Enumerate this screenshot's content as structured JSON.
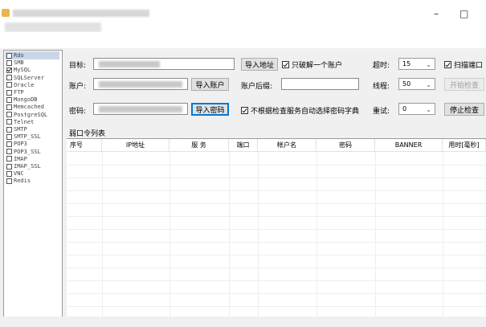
{
  "window": {
    "minimize_glyph": "–",
    "maximize_glyph": "□"
  },
  "services": [
    {
      "label": "Rdo",
      "checked": false
    },
    {
      "label": "SMB",
      "checked": false
    },
    {
      "label": "MySQL",
      "checked": true
    },
    {
      "label": "SQLServer",
      "checked": false
    },
    {
      "label": "Oracle",
      "checked": false
    },
    {
      "label": "FTP",
      "checked": false
    },
    {
      "label": "MongoDB",
      "checked": false
    },
    {
      "label": "Memcached",
      "checked": false
    },
    {
      "label": "PostgreSQL",
      "checked": false
    },
    {
      "label": "Telnet",
      "checked": false
    },
    {
      "label": "SMTP",
      "checked": false
    },
    {
      "label": "SMTP_SSL",
      "checked": false
    },
    {
      "label": "POP3",
      "checked": false
    },
    {
      "label": "POP3_SSL",
      "checked": false
    },
    {
      "label": "IMAP",
      "checked": false
    },
    {
      "label": "IMAP_SSL",
      "checked": false
    },
    {
      "label": "VNC",
      "checked": false
    },
    {
      "label": "Redis",
      "checked": false
    }
  ],
  "form": {
    "target_label": "目标:",
    "account_label": "账户:",
    "password_label": "密码:",
    "import_address": "导入地址",
    "import_account": "导入账户",
    "import_password": "导入密码",
    "only_crack_one": "只破解一个账户",
    "account_suffix_label": "账户后缀:",
    "no_dict_auto": "不根据检查服务自动选择密码字典",
    "timeout_label": "超时:",
    "timeout_value": "15",
    "threads_label": "线程:",
    "threads_value": "50",
    "retry_label": "重试:",
    "retry_value": "0",
    "scan_port": "扫描端口",
    "start_check": "开始检查",
    "stop_check": "停止检查"
  },
  "weak_list_title": "弱口令列表",
  "table": {
    "columns": [
      "序号",
      "IP地址",
      "服 务",
      "端口",
      "帐户名",
      "密码",
      "BANNER",
      "用时[毫秒]"
    ]
  }
}
